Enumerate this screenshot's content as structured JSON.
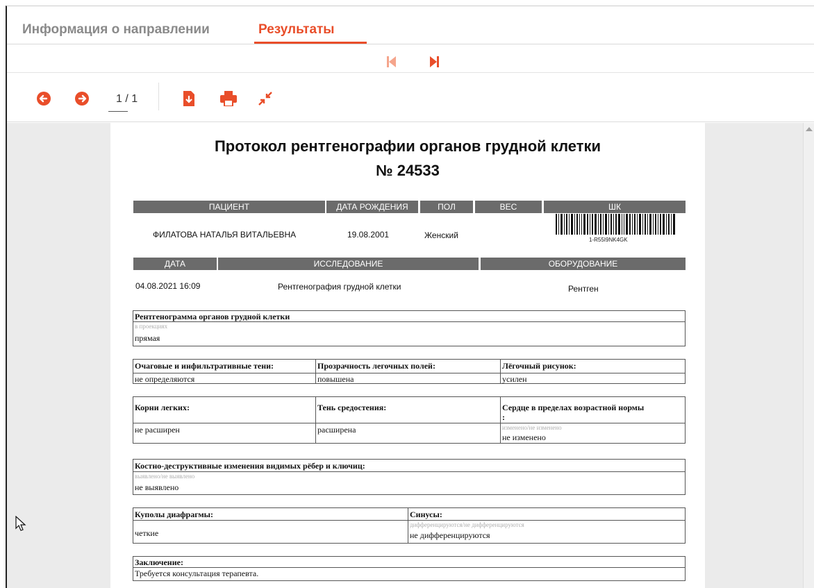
{
  "tabs": [
    {
      "label": "Информация о направлении",
      "active": false
    },
    {
      "label": "Результаты",
      "active": true
    }
  ],
  "colors": {
    "accent": "#e94e2a",
    "header_bg": "#6b6b6b",
    "accent_light": "#f5a58c"
  },
  "toolbar": {
    "prev_icon": "arrow-left-circle-icon",
    "next_icon": "arrow-right-circle-icon",
    "page_indicator": "1 / 1",
    "download_icon": "file-download-icon",
    "print_icon": "print-icon",
    "collapse_icon": "collapse-arrows-icon"
  },
  "report_nav": {
    "first_icon": "first-page-icon",
    "last_icon": "last-page-icon"
  },
  "document": {
    "title_line1": "Протокол рентгенографии органов грудной клетки",
    "title_line2": "№ 24533",
    "patient_headers": {
      "patient": "ПАЦИЕНТ",
      "birth_date": "ДАТА РОЖДЕНИЯ",
      "sex": "ПОЛ",
      "weight": "ВЕС",
      "barcode": "ШК"
    },
    "patient": {
      "name": "ФИЛАТОВА НАТАЛЬЯ ВИТАЛЬЕВНА",
      "birth_date": "19.08.2001",
      "sex": "Женский",
      "weight": "",
      "barcode_text": "1-R55I9NK4GK"
    },
    "study_headers": {
      "date": "ДАТА",
      "study": "ИССЛЕДОВАНИЕ",
      "equipment": "ОБОРУДОВАНИЕ"
    },
    "study": {
      "date": "04.08.2021 16:09",
      "name": "Рентгенография грудной клетки",
      "equipment": "Рентген"
    },
    "sections": {
      "xray": {
        "title": "Рентгенограмма органов грудной клетки",
        "hint": "в проекциях",
        "value": "прямая"
      },
      "row1": {
        "c1_label": "Очаговые и инфильтративные тени:",
        "c1_value": "не определяются",
        "c2_label": "Прозрачность легочных полей:",
        "c2_value": "повышена",
        "c3_label": "Лёгочный рисунок:",
        "c3_value": "усилен"
      },
      "row2": {
        "c1_label": "Корни легких:",
        "c1_value": "не расширен",
        "c2_label": "Тень средостения:",
        "c2_value": "расширена",
        "c3_label": "Сердце в пределах возрастной нормы",
        "c3_colon": ":",
        "c3_hint": "изменено/не изменено",
        "c3_value": "не изменено"
      },
      "bones": {
        "title": "Костно-деструктивные изменения видимых рёбер и ключиц:",
        "hint": "выявлено/не выявлено",
        "value": "не выявлено"
      },
      "row3": {
        "c1_label": "Куполы диафрагмы:",
        "c1_value": "четкие",
        "c2_label": "Синусы:",
        "c2_hint": "дифференцируются/не дифференцируются",
        "c2_value": "не дифференцируются"
      },
      "conclusion": {
        "title": "Заключение:",
        "value": "Требуется консультация терапевта."
      }
    }
  }
}
